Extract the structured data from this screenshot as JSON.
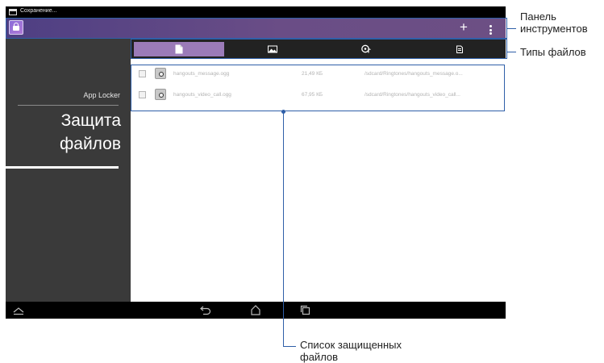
{
  "status_bar": {
    "notification_text": "Сохранение..."
  },
  "sidebar": {
    "app_locker_label": "App Locker",
    "section_title_line1": "Защита",
    "section_title_line2": "файлов"
  },
  "toolbar": {
    "add_icon": "plus-icon",
    "menu_icon": "overflow-menu-icon"
  },
  "tabs": [
    {
      "icon": "document-icon",
      "active": true
    },
    {
      "icon": "image-icon",
      "active": false
    },
    {
      "icon": "music-icon",
      "active": false
    },
    {
      "icon": "file-icon",
      "active": false
    }
  ],
  "files": [
    {
      "name": "hangouts_message.ogg",
      "size": "21,49 КБ",
      "path": "/sdcard/Ringtones/hangouts_message.o..."
    },
    {
      "name": "hangouts_video_call.ogg",
      "size": "67,95 КБ",
      "path": "/sdcard/Ringtones/hangouts_video_call..."
    }
  ],
  "nav_bar": {
    "buttons": [
      "hide-bar-icon",
      "back-icon",
      "home-icon",
      "recent-apps-icon"
    ]
  },
  "callouts": {
    "toolbar_line1": "Панель",
    "toolbar_line2": "инструментов",
    "file_types": "Типы файлов",
    "list_line1": "Список защищенных",
    "list_line2": "файлов"
  },
  "colors": {
    "toolbar": "#5b4585",
    "active_tab": "#9b7bb8",
    "callout": "#2f5fa8",
    "sidebar": "#3a3a3a"
  }
}
